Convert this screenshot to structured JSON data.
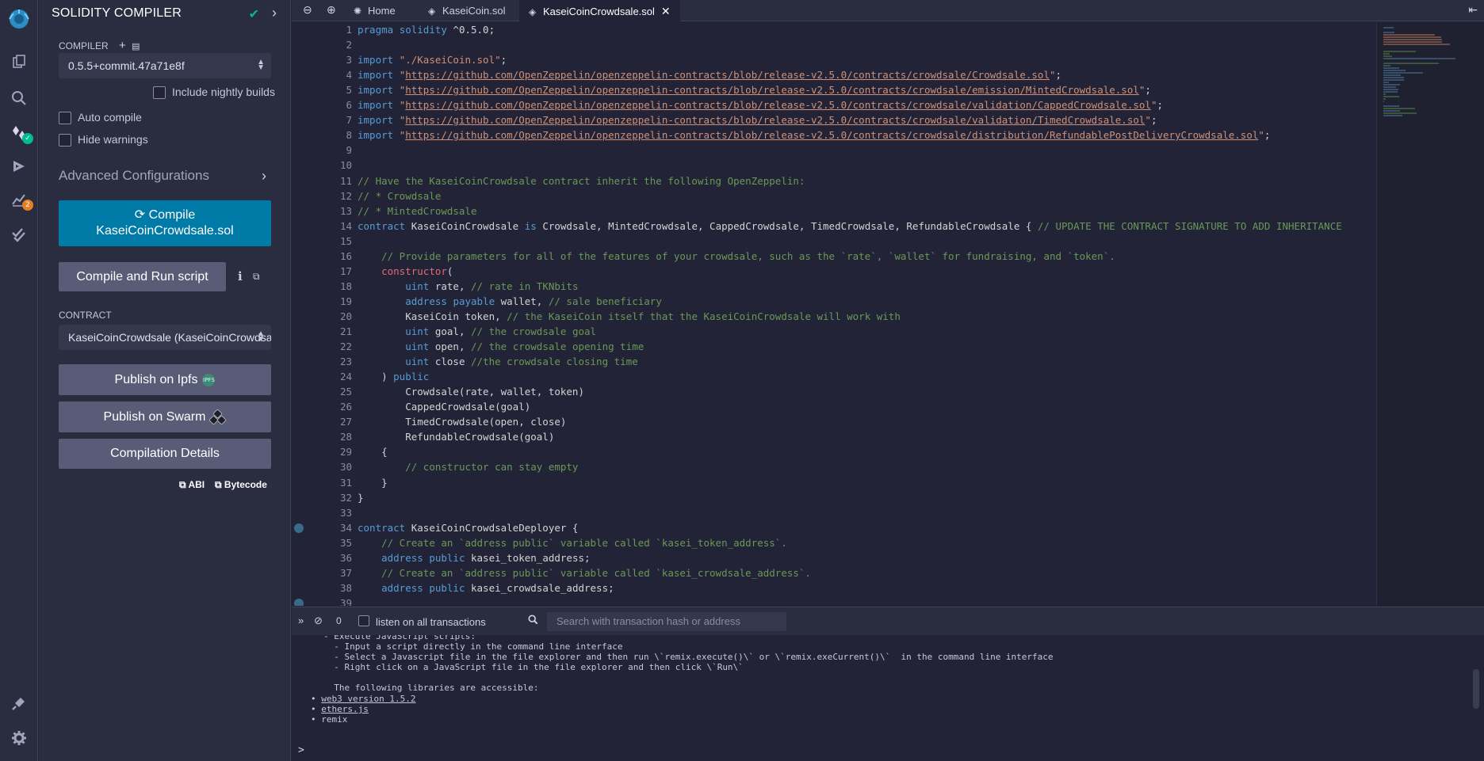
{
  "iconbar": {
    "items": [
      {
        "name": "remix-logo-icon"
      },
      {
        "name": "file-explorer-icon"
      },
      {
        "name": "search-icon"
      },
      {
        "name": "solidity-compiler-icon"
      },
      {
        "name": "deploy-run-icon"
      },
      {
        "name": "analysis-icon",
        "badge": "2"
      },
      {
        "name": "testing-icon"
      }
    ],
    "bottom": [
      {
        "name": "plugin-manager-icon"
      },
      {
        "name": "settings-icon"
      }
    ]
  },
  "sidepanel": {
    "title": "SOLIDITY COMPILER",
    "compiler_label": "COMPILER",
    "compiler_version": "0.5.5+commit.47a71e8f",
    "include_nightly_label": "Include nightly builds",
    "auto_compile_label": "Auto compile",
    "hide_warnings_label": "Hide warnings",
    "advanced_label": "Advanced Configurations",
    "compile_button_line1": "Compile",
    "compile_button_line2": "KaseiCoinCrowdsale.sol",
    "compile_run_label": "Compile and Run script",
    "contract_label": "CONTRACT",
    "contract_value": "KaseiCoinCrowdsale (KaseiCoinCrowdsale.sol)",
    "publish_ipfs_label": "Publish on Ipfs",
    "ipfs_badge": "IPFS",
    "publish_swarm_label": "Publish on Swarm",
    "compilation_details_label": "Compilation Details",
    "abi_label": "ABI",
    "bytecode_label": "Bytecode"
  },
  "tabs": [
    {
      "label": "Home",
      "icon": "home-icon"
    },
    {
      "label": "KaseiCoin.sol",
      "icon": "solidity-file-icon"
    },
    {
      "label": "KaseiCoinCrowdsale.sol",
      "icon": "solidity-file-icon",
      "active": true
    }
  ],
  "editor": {
    "breakpoint_lines": [
      34,
      39
    ],
    "lines": [
      [
        [
          "kw",
          "pragma"
        ],
        [
          "tx",
          " "
        ],
        [
          "kw",
          "solidity"
        ],
        [
          "tx",
          " ^0.5.0;"
        ]
      ],
      [],
      [
        [
          "kw",
          "import"
        ],
        [
          "tx",
          " "
        ],
        [
          "str",
          "\"./KaseiCoin.sol\""
        ],
        [
          "tx",
          ";"
        ]
      ],
      [
        [
          "kw",
          "import"
        ],
        [
          "tx",
          " "
        ],
        [
          "str",
          "\""
        ],
        [
          "url",
          "https://github.com/OpenZeppelin/openzeppelin-contracts/blob/release-v2.5.0/contracts/crowdsale/Crowdsale.sol"
        ],
        [
          "str",
          "\""
        ],
        [
          "tx",
          ";"
        ]
      ],
      [
        [
          "kw",
          "import"
        ],
        [
          "tx",
          " "
        ],
        [
          "str",
          "\""
        ],
        [
          "url",
          "https://github.com/OpenZeppelin/openzeppelin-contracts/blob/release-v2.5.0/contracts/crowdsale/emission/MintedCrowdsale.sol"
        ],
        [
          "str",
          "\""
        ],
        [
          "tx",
          ";"
        ]
      ],
      [
        [
          "kw",
          "import"
        ],
        [
          "tx",
          " "
        ],
        [
          "str",
          "\""
        ],
        [
          "url",
          "https://github.com/OpenZeppelin/openzeppelin-contracts/blob/release-v2.5.0/contracts/crowdsale/validation/CappedCrowdsale.sol"
        ],
        [
          "str",
          "\""
        ],
        [
          "tx",
          ";"
        ]
      ],
      [
        [
          "kw",
          "import"
        ],
        [
          "tx",
          " "
        ],
        [
          "str",
          "\""
        ],
        [
          "url",
          "https://github.com/OpenZeppelin/openzeppelin-contracts/blob/release-v2.5.0/contracts/crowdsale/validation/TimedCrowdsale.sol"
        ],
        [
          "str",
          "\""
        ],
        [
          "tx",
          ";"
        ]
      ],
      [
        [
          "kw",
          "import"
        ],
        [
          "tx",
          " "
        ],
        [
          "str",
          "\""
        ],
        [
          "url",
          "https://github.com/OpenZeppelin/openzeppelin-contracts/blob/release-v2.5.0/contracts/crowdsale/distribution/RefundablePostDeliveryCrowdsale.sol"
        ],
        [
          "str",
          "\""
        ],
        [
          "tx",
          ";"
        ]
      ],
      [],
      [],
      [
        [
          "cm",
          "// Have the KaseiCoinCrowdsale contract inherit the following OpenZeppelin:"
        ]
      ],
      [
        [
          "cm",
          "// * Crowdsale"
        ]
      ],
      [
        [
          "cm",
          "// * MintedCrowdsale"
        ]
      ],
      [
        [
          "kw",
          "contract"
        ],
        [
          "tx",
          " KaseiCoinCrowdsale "
        ],
        [
          "kw",
          "is"
        ],
        [
          "tx",
          " Crowdsale, MintedCrowdsale, CappedCrowdsale, TimedCrowdsale, RefundableCrowdsale { "
        ],
        [
          "cm",
          "// UPDATE THE CONTRACT SIGNATURE TO ADD INHERITANCE"
        ]
      ],
      [],
      [
        [
          "tx",
          "    "
        ],
        [
          "cm",
          "// Provide parameters for all of the features of your crowdsale, such as the `rate`, `wallet` for fundraising, and `token`."
        ]
      ],
      [
        [
          "tx",
          "    "
        ],
        [
          "fn",
          "constructor"
        ],
        [
          "tx",
          "("
        ]
      ],
      [
        [
          "tx",
          "        "
        ],
        [
          "kw",
          "uint"
        ],
        [
          "tx",
          " rate, "
        ],
        [
          "cm",
          "// rate in TKNbits"
        ]
      ],
      [
        [
          "tx",
          "        "
        ],
        [
          "kw",
          "address"
        ],
        [
          "tx",
          " "
        ],
        [
          "kw",
          "payable"
        ],
        [
          "tx",
          " wallet, "
        ],
        [
          "cm",
          "// sale beneficiary"
        ]
      ],
      [
        [
          "tx",
          "        KaseiCoin token, "
        ],
        [
          "cm",
          "// the KaseiCoin itself that the KaseiCoinCrowdsale will work with"
        ]
      ],
      [
        [
          "tx",
          "        "
        ],
        [
          "kw",
          "uint"
        ],
        [
          "tx",
          " goal, "
        ],
        [
          "cm",
          "// the crowdsale goal"
        ]
      ],
      [
        [
          "tx",
          "        "
        ],
        [
          "kw",
          "uint"
        ],
        [
          "tx",
          " open, "
        ],
        [
          "cm",
          "// the crowdsale opening time"
        ]
      ],
      [
        [
          "tx",
          "        "
        ],
        [
          "kw",
          "uint"
        ],
        [
          "tx",
          " close "
        ],
        [
          "cm",
          "//the crowdsale closing time"
        ]
      ],
      [
        [
          "tx",
          "    ) "
        ],
        [
          "kw",
          "public"
        ]
      ],
      [
        [
          "tx",
          "        Crowdsale(rate, wallet, token)"
        ]
      ],
      [
        [
          "tx",
          "        CappedCrowdsale(goal)"
        ]
      ],
      [
        [
          "tx",
          "        TimedCrowdsale(open, close)"
        ]
      ],
      [
        [
          "tx",
          "        RefundableCrowdsale(goal)"
        ]
      ],
      [
        [
          "tx",
          "    {"
        ]
      ],
      [
        [
          "tx",
          "        "
        ],
        [
          "cm",
          "// constructor can stay empty"
        ]
      ],
      [
        [
          "tx",
          "    }"
        ]
      ],
      [
        [
          "tx",
          "}"
        ]
      ],
      [],
      [
        [
          "kw",
          "contract"
        ],
        [
          "tx",
          " KaseiCoinCrowdsaleDeployer {"
        ]
      ],
      [
        [
          "tx",
          "    "
        ],
        [
          "cm",
          "// Create an `address public` variable called `kasei_token_address`."
        ]
      ],
      [
        [
          "tx",
          "    "
        ],
        [
          "kw",
          "address"
        ],
        [
          "tx",
          " "
        ],
        [
          "kw",
          "public"
        ],
        [
          "tx",
          " kasei_token_address;"
        ]
      ],
      [
        [
          "tx",
          "    "
        ],
        [
          "cm",
          "// Create an `address public` variable called `kasei_crowdsale_address`."
        ]
      ],
      [
        [
          "tx",
          "    "
        ],
        [
          "kw",
          "address"
        ],
        [
          "tx",
          " "
        ],
        [
          "kw",
          "public"
        ],
        [
          "tx",
          " kasei_crowdsale_address;"
        ]
      ],
      []
    ]
  },
  "terminal": {
    "count": "0",
    "listen_label": "listen on all transactions",
    "search_placeholder": "Search with transaction hash or address",
    "lines": [
      "- Execute JavaScript scripts:",
      "  - Input a script directly in the command line interface",
      "  - Select a Javascript file in the file explorer and then run \\`remix.execute()\\` or \\`remix.exeCurrent()\\`  in the command line interface",
      "  - Right click on a JavaScript file in the file explorer and then click \\`Run\\`",
      "",
      "  The following libraries are accessible:"
    ],
    "libraries": [
      "web3 version 1.5.2",
      "ethers.js",
      "remix"
    ],
    "prompt": ">"
  }
}
